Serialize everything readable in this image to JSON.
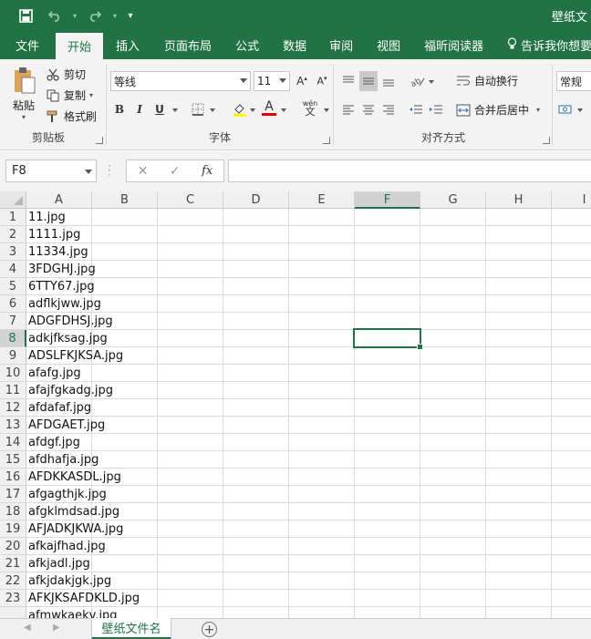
{
  "qat": {
    "customize_glyph": "▾"
  },
  "title": "壁纸文",
  "tabs": [
    "文件",
    "开始",
    "插入",
    "页面布局",
    "公式",
    "数据",
    "审阅",
    "视图",
    "福昕阅读器"
  ],
  "active_tab": "开始",
  "tell_me": "告诉我你想要",
  "ribbon": {
    "clipboard": {
      "paste": "粘贴",
      "cut": "剪切",
      "copy": "复制",
      "format_painter": "格式刷",
      "label": "剪贴板"
    },
    "font": {
      "name": "等线",
      "size": "11",
      "bold": "B",
      "italic": "I",
      "underline": "U",
      "font_color_glyph": "A",
      "phonetic_glyph": "wén",
      "label": "字体"
    },
    "alignment": {
      "wrap_text": "自动换行",
      "merge_center": "合并后居中",
      "label": "对齐方式"
    },
    "number": {
      "format": "常规"
    }
  },
  "formula_bar": {
    "name_box": "F8",
    "cancel": "✕",
    "enter": "✓",
    "fx": "fx",
    "content": ""
  },
  "columns": [
    "A",
    "B",
    "C",
    "D",
    "E",
    "F",
    "G",
    "H",
    "I"
  ],
  "selected_column": "F",
  "selected_row": 8,
  "rows": [
    {
      "n": "1",
      "a": "11.jpg"
    },
    {
      "n": "2",
      "a": "1111.jpg"
    },
    {
      "n": "3",
      "a": "11334.jpg"
    },
    {
      "n": "4",
      "a": "3FDGHJ.jpg"
    },
    {
      "n": "5",
      "a": "6TTY67.jpg"
    },
    {
      "n": "6",
      "a": "adflkjww.jpg"
    },
    {
      "n": "7",
      "a": "ADGFDHSJ.jpg"
    },
    {
      "n": "8",
      "a": "adkjfksag.jpg"
    },
    {
      "n": "9",
      "a": "ADSLFKJKSA.jpg"
    },
    {
      "n": "10",
      "a": "afafg.jpg"
    },
    {
      "n": "11",
      "a": "afajfgkadg.jpg"
    },
    {
      "n": "12",
      "a": "afdafaf.jpg"
    },
    {
      "n": "13",
      "a": "AFDGAET.jpg"
    },
    {
      "n": "14",
      "a": "afdgf.jpg"
    },
    {
      "n": "15",
      "a": "afdhafja.jpg"
    },
    {
      "n": "16",
      "a": "AFDKKASDL.jpg"
    },
    {
      "n": "17",
      "a": "afgagthjk.jpg"
    },
    {
      "n": "18",
      "a": "afgklmdsad.jpg"
    },
    {
      "n": "19",
      "a": "AFJADKJKWA.jpg"
    },
    {
      "n": "20",
      "a": "afkajfhad.jpg"
    },
    {
      "n": "21",
      "a": "afkjadl.jpg"
    },
    {
      "n": "22",
      "a": "afkjdakjgk.jpg"
    },
    {
      "n": "23",
      "a": "AFKJKSAFDKLD.jpg"
    },
    {
      "n": "",
      "a": "afmwkaekv.jpg"
    }
  ],
  "sheet_tab": "壁纸文件名",
  "colors": {
    "accent": "#217346"
  }
}
